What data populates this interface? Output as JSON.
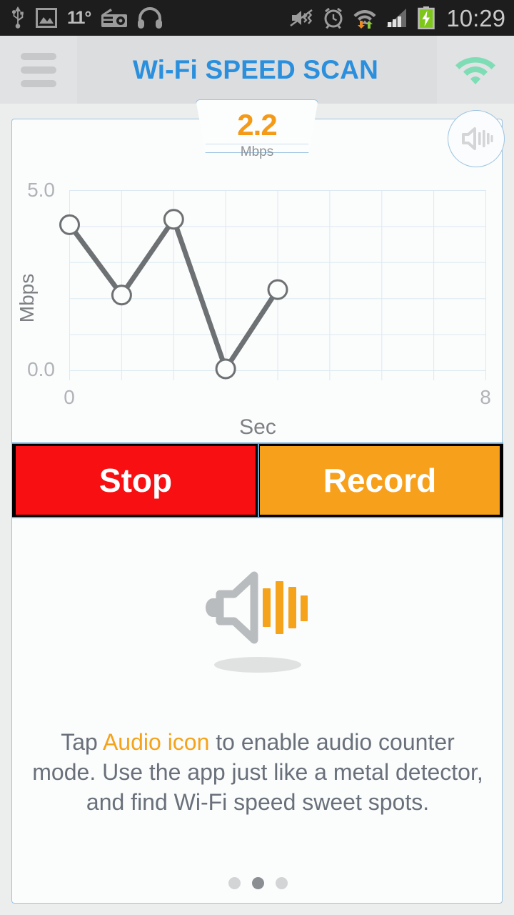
{
  "statusbar": {
    "temperature": "11°",
    "clock": "10:29",
    "left_icons": [
      "usb-icon",
      "gallery-image-icon",
      "temperature-label",
      "fm-radio-icon",
      "headphones-icon"
    ],
    "right_icons": [
      "mute-vibrate-icon",
      "alarm-clock-icon",
      "wifi-transfer-icon",
      "cellular-signal-icon",
      "battery-charging-icon"
    ],
    "colors": {
      "background": "#1d1d1d",
      "icon": "#9b9b9b",
      "text": "#c9c9c9",
      "battery": "#7ec71a"
    }
  },
  "appbar": {
    "menu_icon": "hamburger-menu-icon",
    "title": "Wi-Fi SPEED SCAN",
    "wifi_icon": "wifi-status-icon",
    "colors": {
      "background": "#dcdddf",
      "title": "#2a8fdd",
      "wifi": "#7fddb5"
    }
  },
  "card": {
    "badge": {
      "value": "2.2",
      "unit": "Mbps",
      "color": "#f59a17"
    },
    "audio_button": {
      "icon": "speaker-audio-icon",
      "label": "Audio"
    }
  },
  "chart_data": {
    "type": "line",
    "title": "",
    "xlabel": "Sec",
    "ylabel": "Mbps",
    "x": [
      0,
      1,
      2,
      3,
      4
    ],
    "values": [
      4.05,
      2.1,
      4.2,
      0.05,
      2.25
    ],
    "xtick_labels": [
      "0",
      "8"
    ],
    "ytick_labels": [
      "0.0",
      "5.0"
    ],
    "xlim": [
      0,
      8
    ],
    "ylim": [
      0,
      5
    ],
    "grid": true,
    "grid_x_divisions": 8,
    "grid_y_divisions": 5,
    "legend": "none",
    "line_color": "#6e7173",
    "marker": "open-circle",
    "grid_color": "#dce9f2"
  },
  "buttons": {
    "stop": {
      "label": "Stop",
      "color": "#f70f11"
    },
    "record": {
      "label": "Record",
      "color": "#f7a01c"
    }
  },
  "promo": {
    "icon": "speaker-audio-icon",
    "hint_prefix": "Tap ",
    "hint_highlight": "Audio icon",
    "hint_suffix": " to enable audio counter mode. Use the app just like a metal detector, and find Wi-Fi speed sweet spots.",
    "highlight_color": "#f5a31a"
  },
  "pager": {
    "count": 3,
    "active_index": 1
  }
}
